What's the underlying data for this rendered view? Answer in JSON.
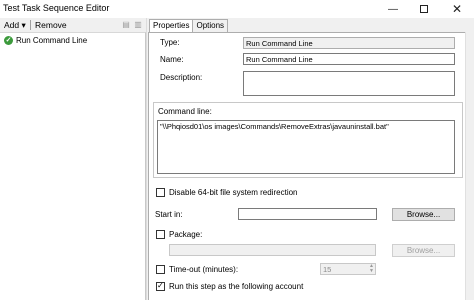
{
  "window": {
    "title": "Test Task Sequence Editor"
  },
  "toolbar": {
    "add_label": "Add",
    "add_arrow": "▾",
    "remove_label": "Remove"
  },
  "tree": {
    "items": [
      {
        "label": "Run Command Line",
        "status_icon": "check-circle-icon",
        "status_color": "#3c9a3c"
      }
    ]
  },
  "tabs": [
    {
      "label": "Properties",
      "active": true
    },
    {
      "label": "Options",
      "active": false
    }
  ],
  "properties": {
    "type_label": "Type:",
    "type_value": "Run Command Line",
    "name_label": "Name:",
    "name_value": "Run Command Line",
    "description_label": "Description:",
    "description_value": "",
    "command_line_label": "Command line:",
    "command_line_value": "\"\\\\Phqiosd01\\os images\\Commands\\RemoveExtras\\javauninstall.bat\"",
    "disable_64bit_label": "Disable 64-bit file system redirection",
    "start_in_label": "Start in:",
    "start_in_value": "",
    "browse_label": "Browse...",
    "package_label": "Package:",
    "package_value": "",
    "package_browse_label": "Browse...",
    "timeout_label": "Time-out (minutes):",
    "timeout_value": "15",
    "run_as_label": "Run this step as the following account"
  },
  "checkboxes": {
    "disable_64bit": false,
    "package": false,
    "timeout": false,
    "run_as": true
  }
}
